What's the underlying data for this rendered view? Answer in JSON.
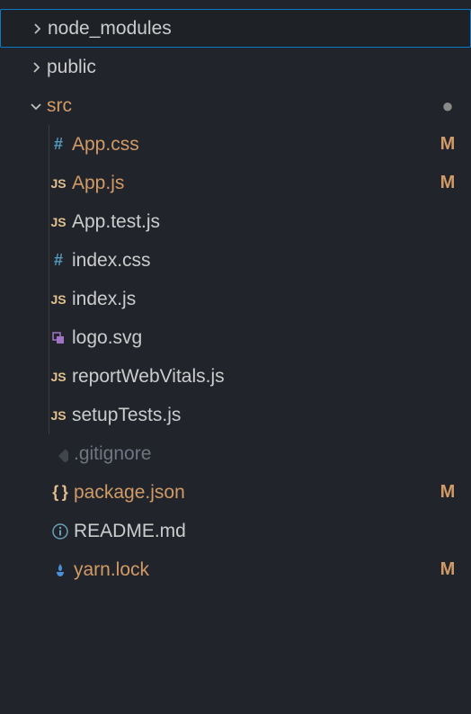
{
  "explorer": {
    "items": [
      {
        "kind": "folder",
        "label": "node_modules",
        "expanded": false,
        "selected": true,
        "depth": 0,
        "icon": "chevron-right",
        "status": ""
      },
      {
        "kind": "folder",
        "label": "public",
        "expanded": false,
        "selected": false,
        "depth": 0,
        "icon": "chevron-right",
        "status": ""
      },
      {
        "kind": "folder",
        "label": "src",
        "expanded": true,
        "selected": false,
        "depth": 0,
        "icon": "chevron-down",
        "status": "dot",
        "modified": true
      },
      {
        "kind": "file",
        "label": "App.css",
        "depth": 1,
        "icon": "hash",
        "status": "M",
        "modified": true
      },
      {
        "kind": "file",
        "label": "App.js",
        "depth": 1,
        "icon": "js",
        "status": "M",
        "modified": true
      },
      {
        "kind": "file",
        "label": "App.test.js",
        "depth": 1,
        "icon": "js",
        "status": ""
      },
      {
        "kind": "file",
        "label": "index.css",
        "depth": 1,
        "icon": "hash",
        "status": ""
      },
      {
        "kind": "file",
        "label": "index.js",
        "depth": 1,
        "icon": "js",
        "status": ""
      },
      {
        "kind": "file",
        "label": "logo.svg",
        "depth": 1,
        "icon": "svg",
        "status": ""
      },
      {
        "kind": "file",
        "label": "reportWebVitals.js",
        "depth": 1,
        "icon": "js",
        "status": ""
      },
      {
        "kind": "file",
        "label": "setupTests.js",
        "depth": 1,
        "icon": "js",
        "status": ""
      },
      {
        "kind": "file",
        "label": ".gitignore",
        "depth": 0,
        "icon": "git-diamond",
        "status": "",
        "dimmed": true
      },
      {
        "kind": "file",
        "label": "package.json",
        "depth": 0,
        "icon": "json",
        "status": "M",
        "modified": true
      },
      {
        "kind": "file",
        "label": "README.md",
        "depth": 0,
        "icon": "info",
        "status": ""
      },
      {
        "kind": "file",
        "label": "yarn.lock",
        "depth": 0,
        "icon": "yarn",
        "status": "M",
        "modified": true
      }
    ]
  }
}
